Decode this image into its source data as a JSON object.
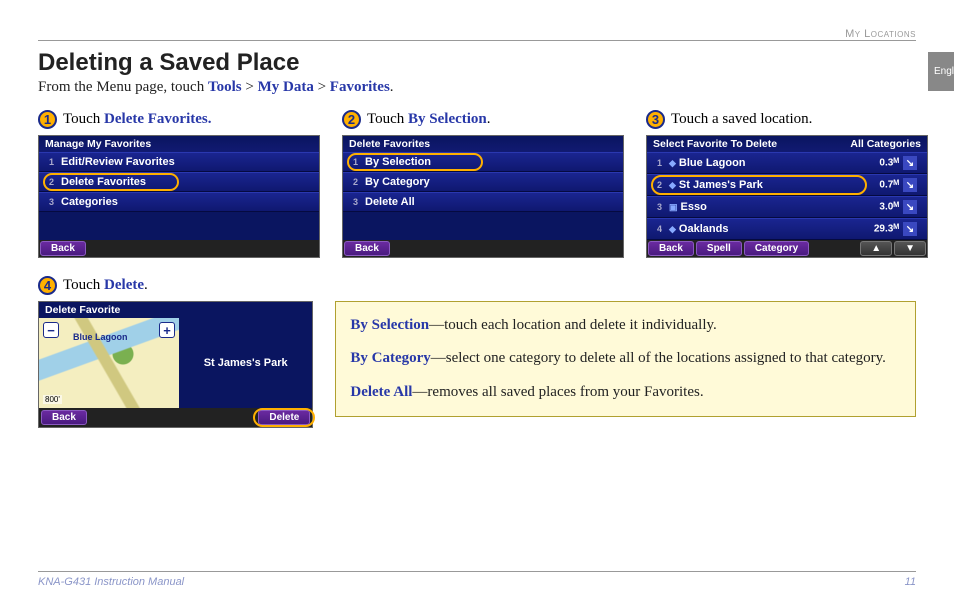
{
  "header": {
    "section": "My Locations",
    "side_tab": "English",
    "title": "Deleting a Saved Place",
    "subtitle_pre": "From the Menu page, touch ",
    "path1": "Tools",
    "path2": "My Data",
    "path3": "Favorites",
    "sep": " > "
  },
  "steps": {
    "s1": {
      "num": "1",
      "pre": "Touch ",
      "hl": "Delete Favorites."
    },
    "s2": {
      "num": "2",
      "pre": "Touch ",
      "hl": "By Selection",
      "post": "."
    },
    "s3": {
      "num": "3",
      "text": "Touch a saved location."
    },
    "s4": {
      "num": "4",
      "pre": "Touch ",
      "hl": "Delete",
      "post": "."
    }
  },
  "dev1": {
    "title": "Manage My Favorites",
    "r1": "Edit/Review Favorites",
    "r2": "Delete Favorites",
    "r3": "Categories",
    "back": "Back"
  },
  "dev2": {
    "title": "Delete Favorites",
    "r1": "By Selection",
    "r2": "By Category",
    "r3": "Delete All",
    "back": "Back"
  },
  "dev3": {
    "title": "Select Favorite To Delete",
    "title_right": "All Categories",
    "rows": [
      {
        "idx": "1",
        "name": "Blue Lagoon",
        "dist": "0.3",
        "hl": false
      },
      {
        "idx": "2",
        "name": "St James's Park",
        "dist": "0.7",
        "hl": true
      },
      {
        "idx": "3",
        "name": "Esso",
        "dist": "3.0",
        "hl": false
      },
      {
        "idx": "4",
        "name": "Oaklands",
        "dist": "29.3",
        "hl": false
      }
    ],
    "back": "Back",
    "spell": "Spell",
    "category": "Category"
  },
  "dev4": {
    "title": "Delete Favorite",
    "map_label": "Blue Lagoon",
    "scale": "800'",
    "place": "St James's Park",
    "back": "Back",
    "delete": "Delete"
  },
  "info": {
    "t1": "By Selection",
    "d1": "—touch each location and delete it individually.",
    "t2": "By Category",
    "d2": "—select one category to delete all of the locations assigned to that category.",
    "t3": "Delete All",
    "d3": "—removes all saved places from your Favorites."
  },
  "footer": {
    "manual": "KNA-G431 Instruction Manual",
    "page": "11"
  },
  "glyph": {
    "mi": "ᴹ",
    "arrow": "↘"
  }
}
